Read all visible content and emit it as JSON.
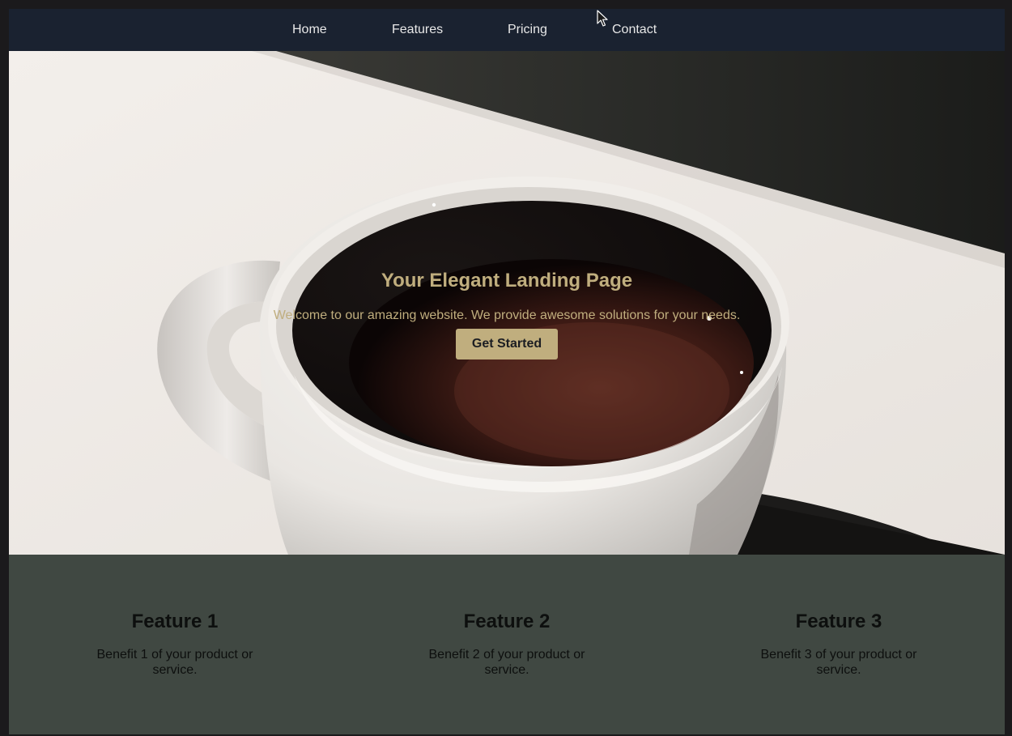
{
  "nav": {
    "items": [
      "Home",
      "Features",
      "Pricing",
      "Contact"
    ]
  },
  "hero": {
    "title": "Your Elegant Landing Page",
    "subtitle": "Welcome to our amazing website. We provide awesome solutions for your needs.",
    "cta_label": "Get Started"
  },
  "features": [
    {
      "title": "Feature 1",
      "text": "Benefit 1 of your product or service."
    },
    {
      "title": "Feature 2",
      "text": "Benefit 2 of your product or service."
    },
    {
      "title": "Feature 3",
      "text": "Benefit 3 of your product or service."
    }
  ],
  "colors": {
    "nav_bg": "#1a2230",
    "accent": "#c0ae7e",
    "features_bg": "#404842"
  },
  "icons": {
    "cursor": "arrow-cursor-icon",
    "hero_image": "coffee-cup-image"
  }
}
